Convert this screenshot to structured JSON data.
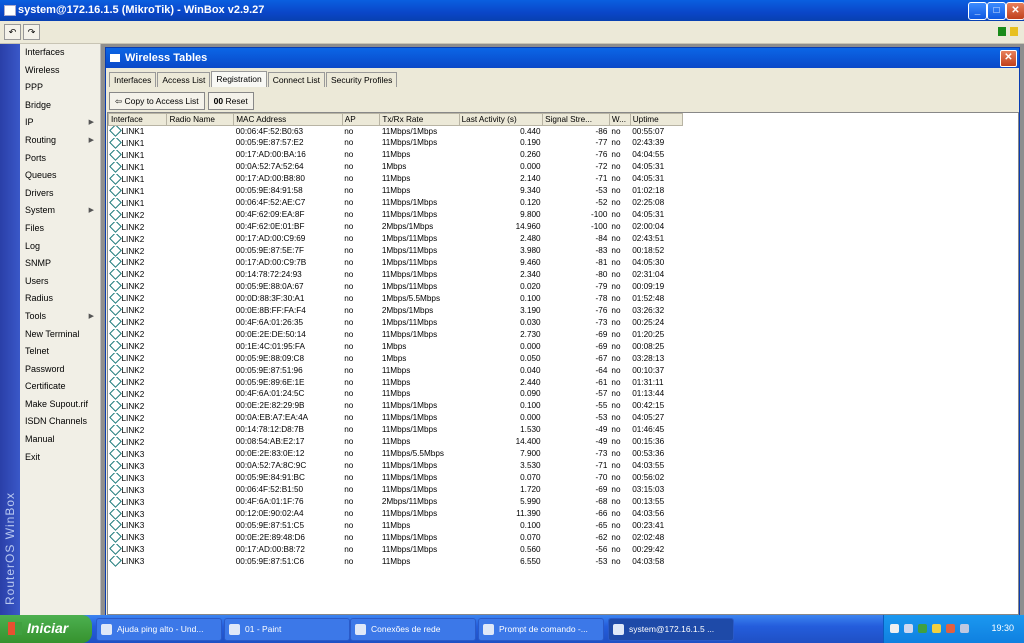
{
  "app": {
    "title": "system@172.16.1.5 (MikroTik) - WinBox v2.9.27"
  },
  "toolbar": {
    "undo_icon": "↶",
    "redo_icon": "↷"
  },
  "sidebar": {
    "brand": "RouterOS WinBox",
    "items": [
      {
        "label": "Interfaces",
        "sub": false
      },
      {
        "label": "Wireless",
        "sub": false
      },
      {
        "label": "PPP",
        "sub": false
      },
      {
        "label": "Bridge",
        "sub": false
      },
      {
        "label": "IP",
        "sub": true
      },
      {
        "label": "Routing",
        "sub": true
      },
      {
        "label": "Ports",
        "sub": false
      },
      {
        "label": "Queues",
        "sub": false
      },
      {
        "label": "Drivers",
        "sub": false
      },
      {
        "label": "System",
        "sub": true
      },
      {
        "label": "Files",
        "sub": false
      },
      {
        "label": "Log",
        "sub": false
      },
      {
        "label": "SNMP",
        "sub": false
      },
      {
        "label": "Users",
        "sub": false
      },
      {
        "label": "Radius",
        "sub": false
      },
      {
        "label": "Tools",
        "sub": true
      },
      {
        "label": "New Terminal",
        "sub": false
      },
      {
        "label": "Telnet",
        "sub": false
      },
      {
        "label": "Password",
        "sub": false
      },
      {
        "label": "Certificate",
        "sub": false
      },
      {
        "label": "Make Supout.rif",
        "sub": false
      },
      {
        "label": "ISDN Channels",
        "sub": false
      },
      {
        "label": "Manual",
        "sub": false
      },
      {
        "label": "Exit",
        "sub": false
      }
    ]
  },
  "window": {
    "title": "Wireless Tables",
    "tabs": [
      {
        "label": "Interfaces",
        "active": false
      },
      {
        "label": "Access List",
        "active": false
      },
      {
        "label": "Registration",
        "active": true
      },
      {
        "label": "Connect List",
        "active": false
      },
      {
        "label": "Security Profiles",
        "active": false
      }
    ],
    "actions": {
      "copy_label": "Copy to Access List",
      "reset_label": "Reset",
      "reset_prefix": "00"
    },
    "columns": [
      "Interface",
      "Radio Name",
      "MAC Address",
      "AP",
      "Tx/Rx Rate",
      "Last Activity (s)",
      "Signal Stre...",
      "W...",
      "Uptime"
    ],
    "rows": [
      [
        "LINK1",
        "",
        "00:06:4F:52:B0:63",
        "no",
        "11Mbps/1Mbps",
        "0.440",
        "-86",
        "no",
        "00:55:07"
      ],
      [
        "LINK1",
        "",
        "00:05:9E:87:57:E2",
        "no",
        "11Mbps/1Mbps",
        "0.190",
        "-77",
        "no",
        "02:43:39"
      ],
      [
        "LINK1",
        "",
        "00:17:AD:00:BA:16",
        "no",
        "11Mbps",
        "0.260",
        "-76",
        "no",
        "04:04:55"
      ],
      [
        "LINK1",
        "",
        "00:0A:52:7A:52:64",
        "no",
        "1Mbps",
        "0.000",
        "-72",
        "no",
        "04:05:31"
      ],
      [
        "LINK1",
        "",
        "00:17:AD:00:B8:80",
        "no",
        "11Mbps",
        "2.140",
        "-71",
        "no",
        "04:05:31"
      ],
      [
        "LINK1",
        "",
        "00:05:9E:84:91:58",
        "no",
        "11Mbps",
        "9.340",
        "-53",
        "no",
        "01:02:18"
      ],
      [
        "LINK1",
        "",
        "00:06:4F:52:AE:C7",
        "no",
        "11Mbps/1Mbps",
        "0.120",
        "-52",
        "no",
        "02:25:08"
      ],
      [
        "LINK2",
        "",
        "00:4F:62:09:EA:8F",
        "no",
        "11Mbps/1Mbps",
        "9.800",
        "-100",
        "no",
        "04:05:31"
      ],
      [
        "LINK2",
        "",
        "00:4F:62:0E:01:BF",
        "no",
        "2Mbps/1Mbps",
        "14.960",
        "-100",
        "no",
        "02:00:04"
      ],
      [
        "LINK2",
        "",
        "00:17:AD:00:C9:69",
        "no",
        "1Mbps/11Mbps",
        "2.480",
        "-84",
        "no",
        "02:43:51"
      ],
      [
        "LINK2",
        "",
        "00:05:9E:87:5E:7F",
        "no",
        "1Mbps/11Mbps",
        "3.980",
        "-83",
        "no",
        "00:18:52"
      ],
      [
        "LINK2",
        "",
        "00:17:AD:00:C9:7B",
        "no",
        "1Mbps/11Mbps",
        "9.460",
        "-81",
        "no",
        "04:05:30"
      ],
      [
        "LINK2",
        "",
        "00:14:78:72:24:93",
        "no",
        "11Mbps/1Mbps",
        "2.340",
        "-80",
        "no",
        "02:31:04"
      ],
      [
        "LINK2",
        "",
        "00:05:9E:88:0A:67",
        "no",
        "1Mbps/11Mbps",
        "0.020",
        "-79",
        "no",
        "00:09:19"
      ],
      [
        "LINK2",
        "",
        "00:0D:88:3F:30:A1",
        "no",
        "1Mbps/5.5Mbps",
        "0.100",
        "-78",
        "no",
        "01:52:48"
      ],
      [
        "LINK2",
        "",
        "00:0E:8B:FF:FA:F4",
        "no",
        "2Mbps/1Mbps",
        "3.190",
        "-76",
        "no",
        "03:26:32"
      ],
      [
        "LINK2",
        "",
        "00:4F:6A:01:26:35",
        "no",
        "1Mbps/11Mbps",
        "0.030",
        "-73",
        "no",
        "00:25:24"
      ],
      [
        "LINK2",
        "",
        "00:0E:2E:DE:50:14",
        "no",
        "11Mbps/1Mbps",
        "2.730",
        "-69",
        "no",
        "01:20:25"
      ],
      [
        "LINK2",
        "",
        "00:1E:4C:01:95:FA",
        "no",
        "1Mbps",
        "0.000",
        "-69",
        "no",
        "00:08:25"
      ],
      [
        "LINK2",
        "",
        "00:05:9E:88:09:C8",
        "no",
        "1Mbps",
        "0.050",
        "-67",
        "no",
        "03:28:13"
      ],
      [
        "LINK2",
        "",
        "00:05:9E:87:51:96",
        "no",
        "11Mbps",
        "0.040",
        "-64",
        "no",
        "00:10:37"
      ],
      [
        "LINK2",
        "",
        "00:05:9E:89:6E:1E",
        "no",
        "11Mbps",
        "2.440",
        "-61",
        "no",
        "01:31:11"
      ],
      [
        "LINK2",
        "",
        "00:4F:6A:01:24:5C",
        "no",
        "11Mbps",
        "0.090",
        "-57",
        "no",
        "01:13:44"
      ],
      [
        "LINK2",
        "",
        "00:0E:2E:82:29:9B",
        "no",
        "11Mbps/1Mbps",
        "0.100",
        "-55",
        "no",
        "00:42:15"
      ],
      [
        "LINK2",
        "",
        "00:0A:EB:A7:EA:4A",
        "no",
        "11Mbps/1Mbps",
        "0.000",
        "-53",
        "no",
        "04:05:27"
      ],
      [
        "LINK2",
        "",
        "00:14:78:12:D8:7B",
        "no",
        "11Mbps/1Mbps",
        "1.530",
        "-49",
        "no",
        "01:46:45"
      ],
      [
        "LINK2",
        "",
        "00:08:54:AB:E2:17",
        "no",
        "11Mbps",
        "14.400",
        "-49",
        "no",
        "00:15:36"
      ],
      [
        "LINK3",
        "",
        "00:0E:2E:83:0E:12",
        "no",
        "11Mbps/5.5Mbps",
        "7.900",
        "-73",
        "no",
        "00:53:36"
      ],
      [
        "LINK3",
        "",
        "00:0A:52:7A:8C:9C",
        "no",
        "11Mbps/1Mbps",
        "3.530",
        "-71",
        "no",
        "04:03:55"
      ],
      [
        "LINK3",
        "",
        "00:05:9E:84:91:BC",
        "no",
        "11Mbps/1Mbps",
        "0.070",
        "-70",
        "no",
        "00:56:02"
      ],
      [
        "LINK3",
        "",
        "00:06:4F:52:B1:50",
        "no",
        "11Mbps/1Mbps",
        "1.720",
        "-69",
        "no",
        "03:15:03"
      ],
      [
        "LINK3",
        "",
        "00:4F:6A:01:1F:76",
        "no",
        "2Mbps/11Mbps",
        "5.990",
        "-68",
        "no",
        "00:13:55"
      ],
      [
        "LINK3",
        "",
        "00:12:0E:90:02:A4",
        "no",
        "11Mbps/1Mbps",
        "11.390",
        "-66",
        "no",
        "04:03:56"
      ],
      [
        "LINK3",
        "",
        "00:05:9E:87:51:C5",
        "no",
        "11Mbps",
        "0.100",
        "-65",
        "no",
        "00:23:41"
      ],
      [
        "LINK3",
        "",
        "00:0E:2E:89:48:D6",
        "no",
        "11Mbps/1Mbps",
        "0.070",
        "-62",
        "no",
        "02:02:48"
      ],
      [
        "LINK3",
        "",
        "00:17:AD:00:B8:72",
        "no",
        "11Mbps/1Mbps",
        "0.560",
        "-56",
        "no",
        "00:29:42"
      ],
      [
        "LINK3",
        "",
        "00:05:9E:87:51:C6",
        "no",
        "11Mbps",
        "6.550",
        "-53",
        "no",
        "04:03:58"
      ]
    ]
  },
  "taskbar": {
    "start_label": "Iniciar",
    "tasks": [
      {
        "label": "Ajuda ping alto - Und...",
        "active": false
      },
      {
        "label": "01 - Paint",
        "active": false
      },
      {
        "label": "Conexões de rede",
        "active": false
      },
      {
        "label": "Prompt de comando -...",
        "active": false
      },
      {
        "label": "system@172.16.1.5 ...",
        "active": true
      }
    ],
    "clock": "19:30"
  }
}
